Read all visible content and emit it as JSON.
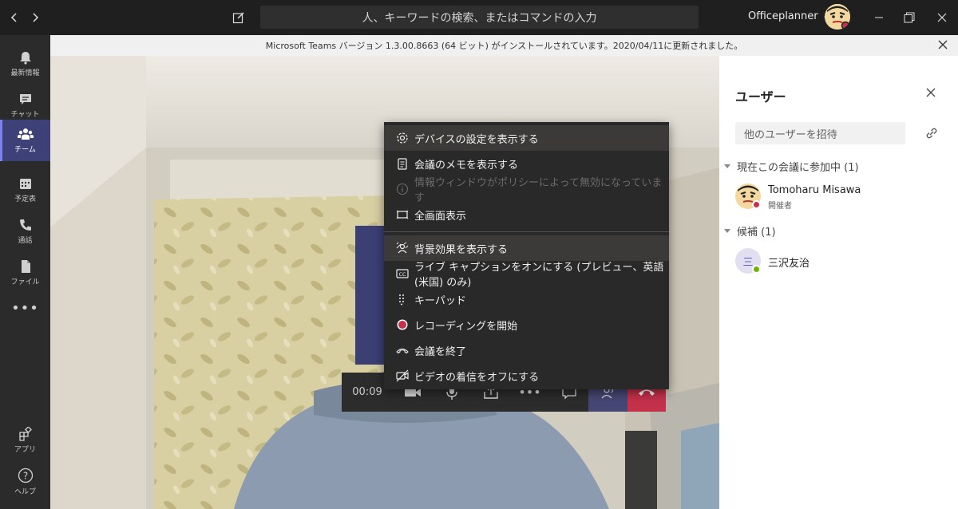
{
  "titlebar": {
    "search_placeholder": "人、キーワードの検索、またはコマンドの入力",
    "profile_name": "Officeplanner"
  },
  "rail": {
    "items": [
      {
        "label": "最新情報",
        "icon": "bell-icon"
      },
      {
        "label": "チャット",
        "icon": "chat-icon"
      },
      {
        "label": "チーム",
        "icon": "teams-icon"
      },
      {
        "label": "予定表",
        "icon": "calendar-icon"
      },
      {
        "label": "通話",
        "icon": "phone-icon"
      },
      {
        "label": "ファイル",
        "icon": "file-icon"
      },
      {
        "label": "アプリ",
        "icon": "apps-icon"
      },
      {
        "label": "ヘルプ",
        "icon": "help-icon"
      }
    ],
    "active_index": 2
  },
  "banner": {
    "text": "Microsoft Teams バージョン 1.3.00.8663 (64 ビット) がインストールされています。2020/04/11に更新されました。"
  },
  "call": {
    "time": "00:09",
    "colors": {
      "hangup": "#c4314b",
      "share_active": "#464775"
    }
  },
  "menu": {
    "items": [
      {
        "label": "デバイスの設定を表示する",
        "icon": "gear-icon",
        "highlighted": true
      },
      {
        "label": "会議のメモを表示する",
        "icon": "notes-icon"
      },
      {
        "label": "情報ウィンドウがポリシーによって無効になっています",
        "icon": "info-icon",
        "disabled": true
      },
      {
        "label": "全画面表示",
        "icon": "fullscreen-icon"
      },
      {
        "label": "背景効果を表示する",
        "icon": "background-effects-icon",
        "highlighted": true
      },
      {
        "label": "ライブ キャプションをオンにする (プレビュー、英語 (米国) のみ)",
        "icon": "captions-icon"
      },
      {
        "label": "キーパッド",
        "icon": "keypad-icon"
      },
      {
        "label": "レコーディングを開始",
        "icon": "record-icon"
      },
      {
        "label": "会議を終了",
        "icon": "end-meeting-icon"
      },
      {
        "label": "ビデオの着信をオフにする",
        "icon": "video-off-icon"
      }
    ]
  },
  "panel": {
    "title": "ユーザー",
    "invite_placeholder": "他のユーザーを招待",
    "in_meeting_label": "現在この会議に参加中 (1)",
    "suggested_label": "候補 (1)",
    "participants": [
      {
        "name": "Tomoharu Misawa",
        "role": "開催者",
        "status_color": "#c4314b"
      }
    ],
    "suggested": [
      {
        "name": "三沢友治",
        "initial": "三",
        "status_color": "#6bb700"
      }
    ]
  }
}
